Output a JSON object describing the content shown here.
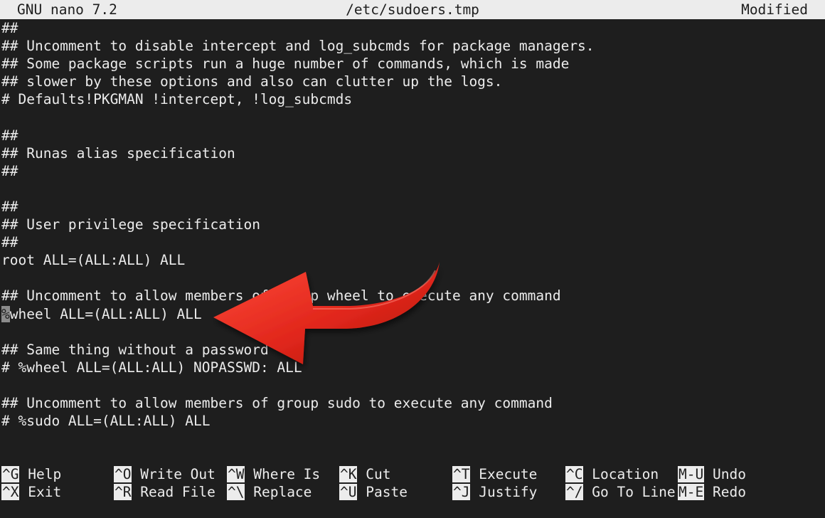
{
  "title_bar": {
    "app": "GNU nano 7.2",
    "file": "/etc/sudoers.tmp",
    "status": "Modified"
  },
  "editor": {
    "lines": [
      "##",
      "## Uncomment to disable intercept and log_subcmds for package managers.",
      "## Some package scripts run a huge number of commands, which is made",
      "## slower by these options and also can clutter up the logs.",
      "# Defaults!PKGMAN !intercept, !log_subcmds",
      "",
      "##",
      "## Runas alias specification",
      "##",
      "",
      "##",
      "## User privilege specification",
      "##",
      "root ALL=(ALL:ALL) ALL",
      "",
      "## Uncomment to allow members of group wheel to execute any command",
      "%wheel ALL=(ALL:ALL) ALL",
      "",
      "## Same thing without a password",
      "# %wheel ALL=(ALL:ALL) NOPASSWD: ALL",
      "",
      "## Uncomment to allow members of group sudo to execute any command",
      "# %sudo ALL=(ALL:ALL) ALL"
    ],
    "cursor_char": "%",
    "cursor_line_rest": "wheel ALL=(ALL:ALL) ALL"
  },
  "shortcuts": {
    "row1": [
      {
        "key": "^G",
        "label": "Help"
      },
      {
        "key": "^O",
        "label": "Write Out"
      },
      {
        "key": "^W",
        "label": "Where Is"
      },
      {
        "key": "^K",
        "label": "Cut"
      },
      {
        "key": "^T",
        "label": "Execute"
      },
      {
        "key": "^C",
        "label": "Location"
      },
      {
        "key": "M-U",
        "label": "Undo"
      }
    ],
    "row2": [
      {
        "key": "^X",
        "label": "Exit"
      },
      {
        "key": "^R",
        "label": "Read File"
      },
      {
        "key": "^\\",
        "label": "Replace"
      },
      {
        "key": "^U",
        "label": "Paste"
      },
      {
        "key": "^J",
        "label": "Justify"
      },
      {
        "key": "^/",
        "label": "Go To Line"
      },
      {
        "key": "M-E",
        "label": "Redo"
      }
    ]
  },
  "overlay": {
    "arrow_icon": "red-curved-arrow-icon",
    "arrow_color": "#e0261b"
  }
}
